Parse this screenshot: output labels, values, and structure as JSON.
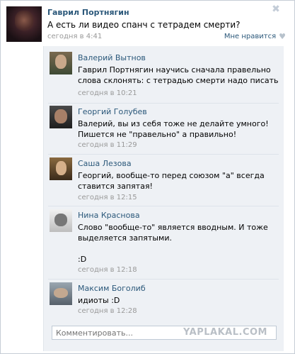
{
  "post": {
    "author": "Гаврил Портнягин",
    "text": "А есть ли видео спанч с тетрадем смерти?",
    "time": "сегодня в 4:41",
    "like_label": "Мне нравится",
    "close_glyph": "✖",
    "heart_glyph": "♥"
  },
  "comments": [
    {
      "author": "Валерий Вытнов",
      "text": "Гаврил Портнягин научись сначала правельно слова склонять: с тетрадью смерти надо писать",
      "time": "сегодня в 10:21"
    },
    {
      "author": "Георгий Голубев",
      "text": "Валерий, вы из себя тоже не делайте умного!\nПишется не \"правельно\" а правильно!",
      "time": "сегодня в 11:29"
    },
    {
      "author": "Саша Лезова",
      "text": "Георгий, вообще-то перед союзом \"а\" всегда ставится запятая!",
      "time": "сегодня в 12:15"
    },
    {
      "author": "Нина Краснова",
      "text": "Слово \"вообще-то\" является вводным. И тоже выделяется запятыми.\n\n:D",
      "time": "сегодня в 12:18"
    },
    {
      "author": "Максим Боголиб",
      "text": "идиоты :D",
      "time": "сегодня в 12:28"
    }
  ],
  "comment_input": {
    "placeholder": "Комментировать..."
  },
  "watermark": "YAPLAKAL.COM"
}
